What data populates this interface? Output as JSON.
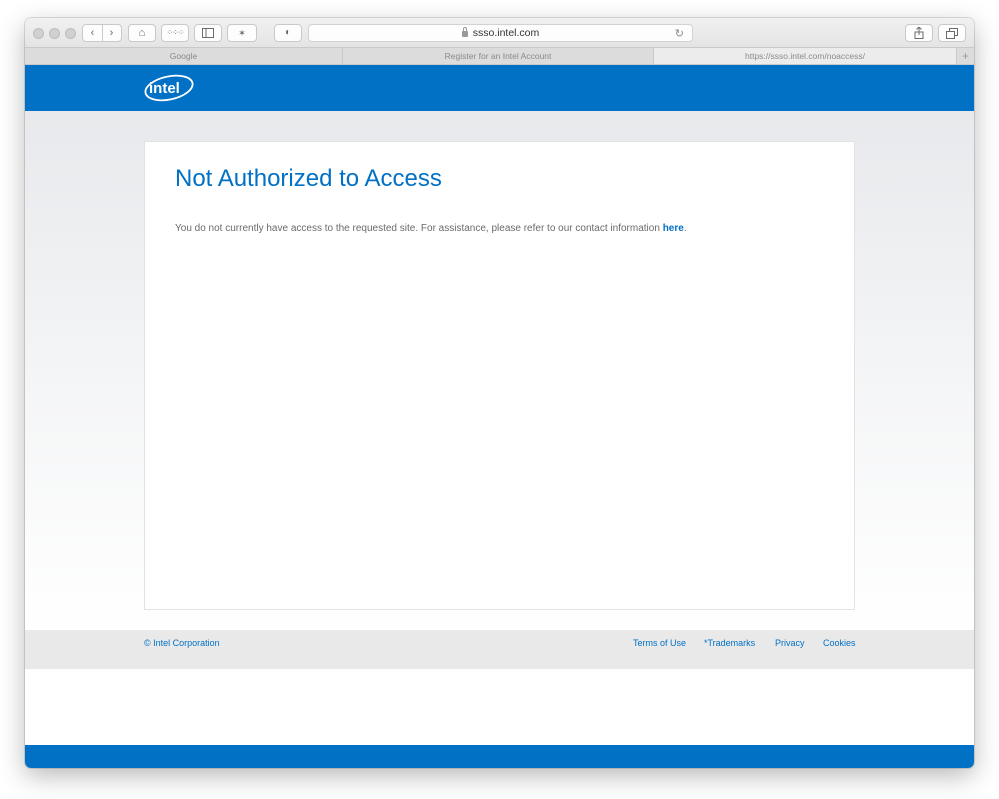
{
  "browser": {
    "url": "ssso.intel.com",
    "tabs": [
      {
        "label": "Google"
      },
      {
        "label": "Register for an Intel Account"
      },
      {
        "label": "https://ssso.intel.com/noaccess/"
      }
    ],
    "add_tab_label": "+"
  },
  "header": {
    "logo_text": "intel"
  },
  "main": {
    "title": "Not Authorized to Access",
    "message": "You do not currently have access to the requested site. For assistance, please refer to our contact information ",
    "link_text": "here",
    "message_end": "."
  },
  "footer": {
    "copyright": "© Intel Corporation",
    "links": [
      "Terms of Use",
      "*Trademarks",
      "Privacy",
      "Cookies"
    ]
  },
  "colors": {
    "brand_blue": "#0071c5",
    "footer_bg": "#e9e9e9"
  }
}
